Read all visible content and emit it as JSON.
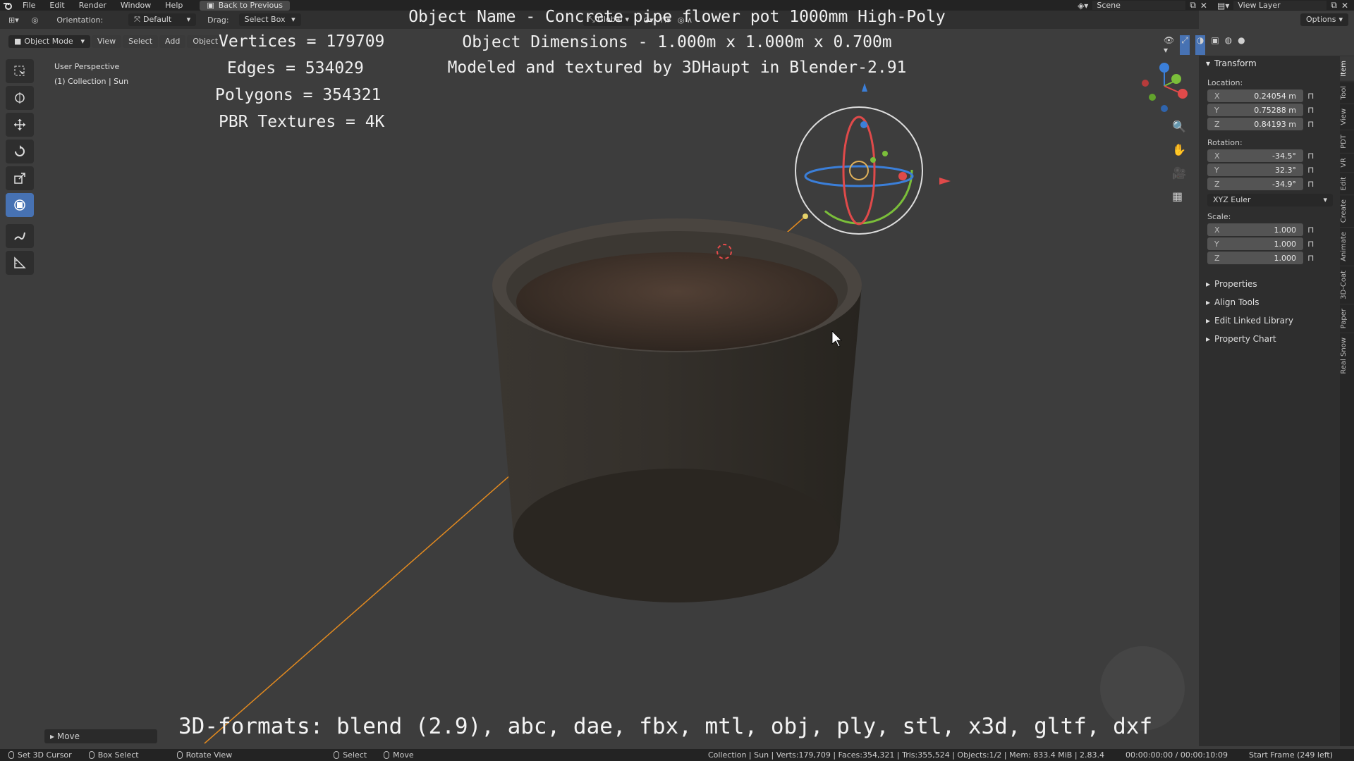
{
  "topbar": {
    "menu": [
      "File",
      "Edit",
      "Render",
      "Window",
      "Help"
    ],
    "back_label": "Back to Previous",
    "scene": "Scene",
    "view_layer": "View Layer"
  },
  "header": {
    "orientation_label": "Orientation:",
    "orientation_value": "Default",
    "drag_label": "Drag:",
    "drag_value": "Select Box",
    "transform_value": "Global",
    "options_label": "Options"
  },
  "header3": {
    "mode": "Object Mode",
    "menus": [
      "View",
      "Select",
      "Add",
      "Object"
    ]
  },
  "viewport": {
    "perspective": "User Perspective",
    "collection": "(1) Collection | Sun"
  },
  "overlay": {
    "stats": [
      "Vertices = 179709",
      "Edges = 534029",
      "Polygons = 354321",
      "PBR Textures = 4K"
    ],
    "title_lines": [
      "Object Name - Concrete pipe flower pot 1000mm High-Poly",
      "Object Dimensions -  1.000m x 1.000m x 0.700m",
      "Modeled and textured by 3DHaupt in Blender-2.91"
    ],
    "formats": "3D-formats: blend (2.9), abc, dae, fbx, mtl, obj, ply, stl, x3d, gltf, dxf"
  },
  "sidepanel": {
    "transform_title": "Transform",
    "location_label": "Location:",
    "location": [
      {
        "axis": "X",
        "value": "0.24054 m"
      },
      {
        "axis": "Y",
        "value": "0.75288 m"
      },
      {
        "axis": "Z",
        "value": "0.84193 m"
      }
    ],
    "rotation_label": "Rotation:",
    "rotation": [
      {
        "axis": "X",
        "value": "-34.5°"
      },
      {
        "axis": "Y",
        "value": "32.3°"
      },
      {
        "axis": "Z",
        "value": "-34.9°"
      }
    ],
    "euler": "XYZ Euler",
    "scale_label": "Scale:",
    "scale": [
      {
        "axis": "X",
        "value": "1.000"
      },
      {
        "axis": "Y",
        "value": "1.000"
      },
      {
        "axis": "Z",
        "value": "1.000"
      }
    ],
    "subpanels": [
      "Properties",
      "Align Tools",
      "Edit Linked Library",
      "Property Chart"
    ]
  },
  "tabs": [
    "Item",
    "Tool",
    "View",
    "PDT",
    "VR",
    "Edit",
    "Create",
    "Animate",
    "3D-Coat",
    "Paper",
    "Real Snow"
  ],
  "move_panel": "Move",
  "statusbar": {
    "hints": [
      "Set 3D Cursor",
      "Box Select",
      "Rotate View",
      "Select",
      "Move"
    ],
    "stats": "Collection | Sun | Verts:179,709 | Faces:354,321 | Tris:355,524 | Objects:1/2 | Mem: 833.4 MiB | 2.83.4",
    "time": "00:00:00:00 / 00:00:10:09",
    "frame": "Start Frame (249 left)"
  },
  "colors": {
    "accent": "#4772b3",
    "background": "#3d3d3d",
    "gizmo_x": "#e04a4a",
    "gizmo_y": "#7bbf3a",
    "gizmo_z": "#3b7fd9",
    "light_line": "#e38a1f"
  }
}
